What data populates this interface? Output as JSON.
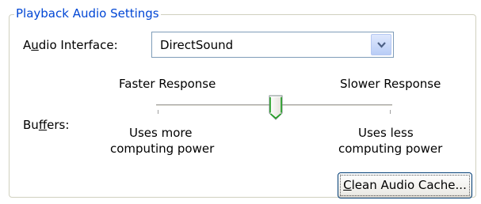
{
  "group": {
    "title": "Playback Audio Settings"
  },
  "audio_interface": {
    "label_pre": "A",
    "label_mnemonic": "u",
    "label_post": "dio Interface:",
    "value": "DirectSound",
    "arrow_icon": "chevron-down-icon"
  },
  "buffers": {
    "label_pre": "Bu",
    "label_mnemonic": "f",
    "label_post": "fers:",
    "left_top": "Faster Response",
    "right_top": "Slower Response",
    "left_bottom_line1": "Uses more",
    "left_bottom_line2": "computing power",
    "right_bottom_line1": "Uses less",
    "right_bottom_line2": "computing power",
    "slider_position_fraction": 0.5,
    "tick_count": 2
  },
  "clean_button": {
    "label_mnemonic": "C",
    "label_post": "lean Audio Cache..."
  },
  "colors": {
    "group_title": "#0046d5",
    "thumb_accent": "#21a121",
    "button_border": "#003c74"
  }
}
